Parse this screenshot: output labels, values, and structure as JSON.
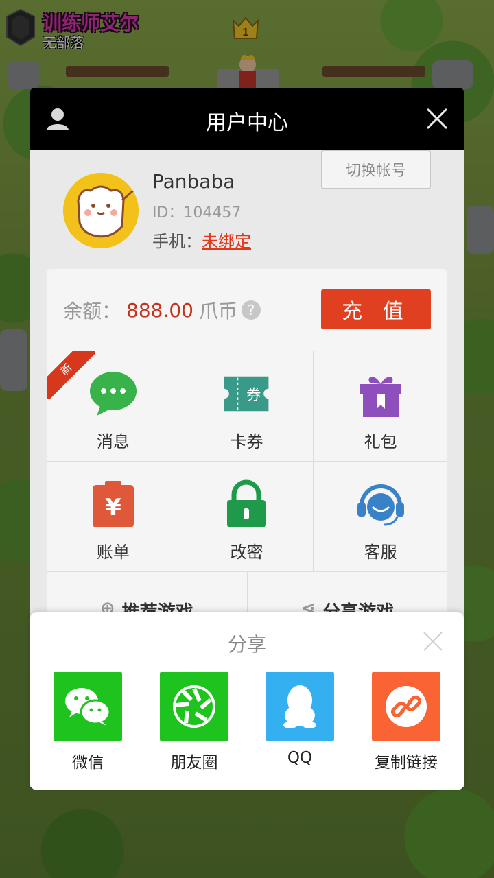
{
  "game": {
    "player_name": "训练师艾尔",
    "clan": "无部落",
    "crown_count": "1"
  },
  "user_center": {
    "title": "用户中心",
    "user": {
      "name": "Panbaba",
      "id_label": "ID：104457",
      "phone_label": "手机：",
      "phone_status": "未绑定"
    },
    "switch_account_label": "切换帐号",
    "balance": {
      "label": "余额：",
      "amount": "888.00",
      "unit": "爪币",
      "help": "?"
    },
    "recharge_label": "充 值",
    "new_badge": "新",
    "grid": [
      {
        "label": "消息",
        "icon": "message-icon",
        "color": "#37b34a"
      },
      {
        "label": "卡券",
        "icon": "coupon-icon",
        "color": "#3a9a8a"
      },
      {
        "label": "礼包",
        "icon": "gift-icon",
        "color": "#8e4fbd"
      },
      {
        "label": "账单",
        "icon": "bill-icon",
        "color": "#e0583a"
      },
      {
        "label": "改密",
        "icon": "lock-icon",
        "color": "#1f9a4a"
      },
      {
        "label": "客服",
        "icon": "customer-service-icon",
        "color": "#3a82c8"
      }
    ],
    "bottom_links": [
      {
        "label": "推荐游戏",
        "icon": "recommend-icon"
      },
      {
        "label": "分享游戏",
        "icon": "share-icon"
      }
    ]
  },
  "share": {
    "title": "分享",
    "items": [
      {
        "label": "微信",
        "icon": "wechat-icon",
        "color": "#1ec31e"
      },
      {
        "label": "朋友圈",
        "icon": "moments-icon",
        "color": "#1ec31e"
      },
      {
        "label": "QQ",
        "icon": "qq-icon",
        "color": "#34aff0"
      },
      {
        "label": "复制链接",
        "icon": "copy-link-icon",
        "color": "#fa6434"
      }
    ]
  }
}
